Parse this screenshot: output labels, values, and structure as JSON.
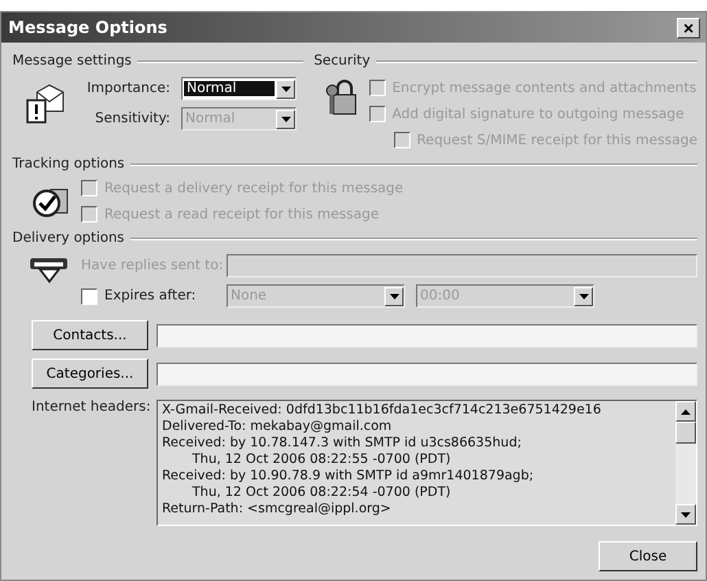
{
  "window": {
    "title": "Message Options",
    "close": "×"
  },
  "message_settings": {
    "heading": "Message settings",
    "fields": [
      {
        "label": "Importance:",
        "value": "Normal",
        "disabled": false,
        "focused": true
      },
      {
        "label": "Sensitivity:",
        "value": "Normal",
        "disabled": true,
        "focused": false
      }
    ]
  },
  "security": {
    "heading": "Security",
    "options": [
      {
        "label": "Encrypt message contents and attachments",
        "checked": false,
        "disabled": true,
        "indented": false
      },
      {
        "label": "Add digital signature to outgoing message",
        "checked": false,
        "disabled": true,
        "indented": false
      },
      {
        "label": "Request S/MIME receipt for this message",
        "checked": false,
        "disabled": true,
        "indented": true
      }
    ]
  },
  "tracking_options": {
    "heading": "Tracking options",
    "options": [
      {
        "label": "Request a delivery receipt for this message",
        "checked": false,
        "disabled": true
      },
      {
        "label": "Request a read receipt for this message",
        "checked": false,
        "disabled": true
      }
    ]
  },
  "delivery_options": {
    "heading": "Delivery options",
    "replies": {
      "label": "Have replies sent to:",
      "disabled": true
    },
    "expires": {
      "label": "Expires after:",
      "checked": false,
      "disabled": false,
      "date": {
        "value": "None",
        "disabled": true
      },
      "time": {
        "value": "00:00",
        "disabled": true
      }
    }
  },
  "contacts_button": "Contacts...",
  "categories_button": "Categories...",
  "internet_headers": {
    "label": "Internet headers:",
    "lines": [
      {
        "text": "X-Gmail-Received: 0dfd13bc11b16fda1ec3cf714c213e6751429e16",
        "continuation": false
      },
      {
        "text": "Delivered-To: mekabay@gmail.com",
        "continuation": false
      },
      {
        "text": "Received: by 10.78.147.3 with SMTP id u3cs86635hud;",
        "continuation": false
      },
      {
        "text": "Thu, 12 Oct 2006 08:22:55 -0700 (PDT)",
        "continuation": true
      },
      {
        "text": "Received: by 10.90.78.9 with SMTP id a9mr1401879agb;",
        "continuation": false
      },
      {
        "text": "Thu, 12 Oct 2006 08:22:54 -0700 (PDT)",
        "continuation": true
      },
      {
        "text": "Return-Path: <smcgreal@ippl.org>",
        "continuation": false
      }
    ]
  },
  "close_button": "Close"
}
